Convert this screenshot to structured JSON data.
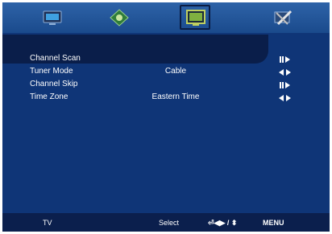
{
  "menu": {
    "tabs": [
      {
        "icon": "picture-tv-icon",
        "selected": false
      },
      {
        "icon": "audio-speaker-icon",
        "selected": false
      },
      {
        "icon": "channel-monitor-icon",
        "selected": true
      },
      {
        "icon": "setup-tools-icon",
        "selected": false
      }
    ],
    "items": [
      {
        "label": "Channel Scan",
        "value": "",
        "control": "enter-icon"
      },
      {
        "label": "Tuner Mode",
        "value": "Cable",
        "control": "left-right-arrows-icon"
      },
      {
        "label": "Channel Skip",
        "value": "",
        "control": "enter-icon"
      },
      {
        "label": "Time Zone",
        "value": "Eastern Time",
        "control": "left-right-arrows-icon"
      }
    ],
    "selected_index": 0
  },
  "footer": {
    "source": "TV",
    "select_label": "Select",
    "nav_hint": "⏎◀▶ / ⬍",
    "menu_label": "MENU"
  },
  "colors": {
    "background": "#0f3577",
    "highlight": "#0a1e4a",
    "footer": "#0b1f4d",
    "text": "#ffffff"
  }
}
